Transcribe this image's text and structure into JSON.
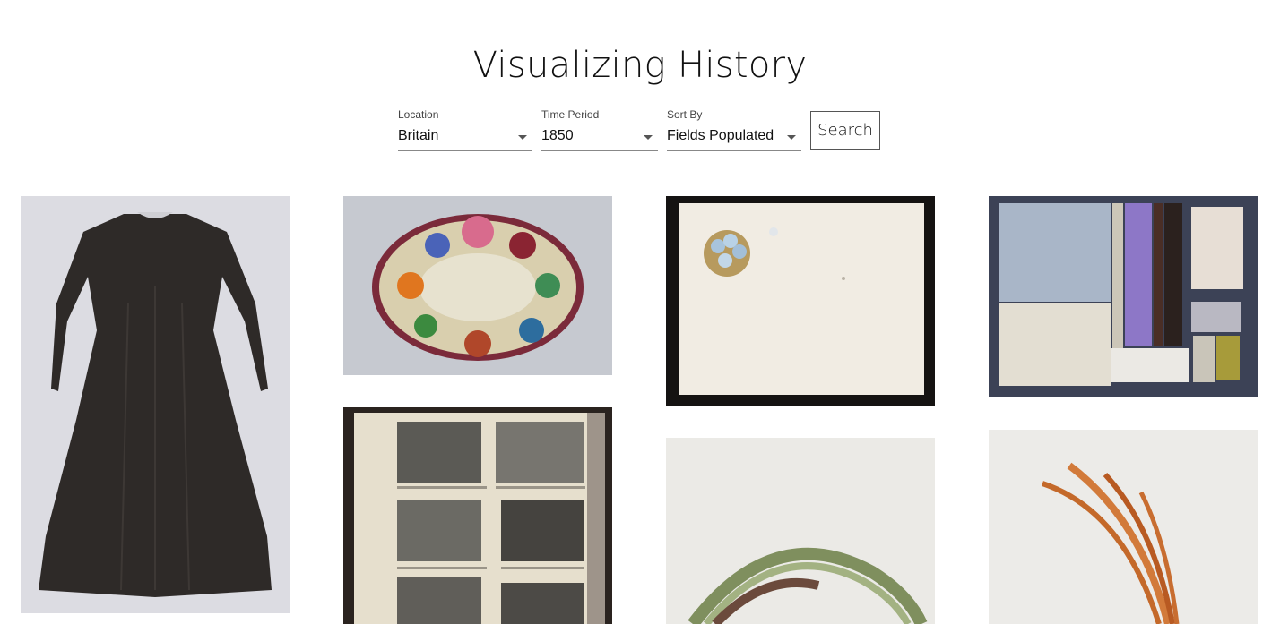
{
  "header": {
    "title": "Visualizing History"
  },
  "filters": {
    "location": {
      "label": "Location",
      "value": "Britain"
    },
    "time_period": {
      "label": "Time Period",
      "value": "1850"
    },
    "sort_by": {
      "label": "Sort By",
      "value": "Fields Populated"
    },
    "search_label": "Search"
  },
  "gallery": {
    "items": [
      {
        "subject": "black dress"
      },
      {
        "subject": "beaded floral wreath mat"
      },
      {
        "subject": "card with forget-me-not flowers"
      },
      {
        "subject": "fabric sample board"
      },
      {
        "subject": "photograph album page"
      },
      {
        "subject": "green hair strands"
      },
      {
        "subject": "orange feather plume"
      }
    ]
  }
}
